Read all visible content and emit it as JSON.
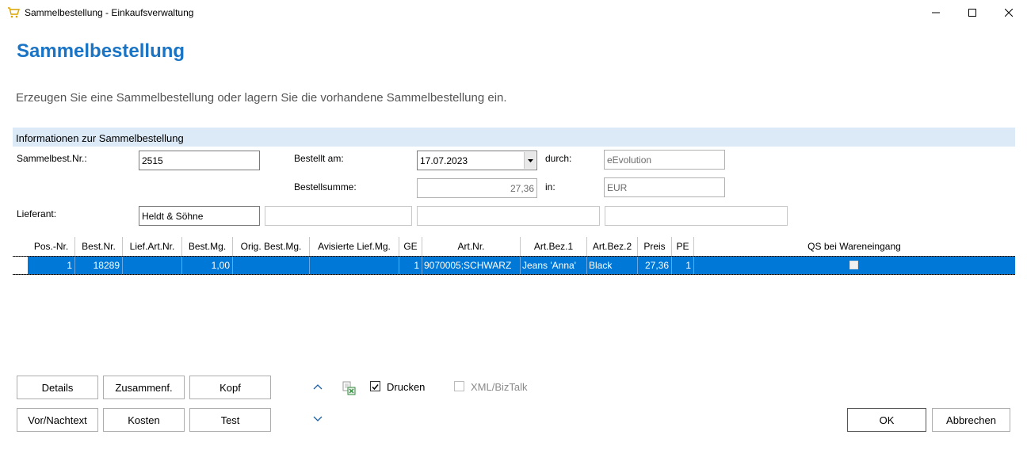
{
  "window": {
    "title": "Sammelbestellung - Einkaufsverwaltung",
    "app_icon": "shopping-cart-icon"
  },
  "page": {
    "title": "Sammelbestellung",
    "subtitle": "Erzeugen Sie eine Sammelbestellung oder lagern Sie die vorhandene Sammelbestellung ein."
  },
  "info": {
    "section_title": "Informationen zur Sammelbestellung",
    "sammelbest_nr_label": "Sammelbest.Nr.:",
    "sammelbest_nr_value": "2515",
    "bestellt_am_label": "Bestellt am:",
    "bestellt_am_value": "17.07.2023",
    "durch_label": "durch:",
    "durch_value": "eEvolution",
    "bestellsumme_label": "Bestellsumme:",
    "bestellsumme_value": "27,36",
    "in_label": "in:",
    "in_value": "EUR",
    "lieferant_label": "Lieferant:",
    "lieferant_value": "Heldt & Söhne"
  },
  "grid": {
    "columns": [
      "Pos.-Nr.",
      "Best.Nr.",
      "Lief.Art.Nr.",
      "Best.Mg.",
      "Orig. Best.Mg.",
      "Avisierte Lief.Mg.",
      "GE",
      "Art.Nr.",
      "Art.Bez.1",
      "Art.Bez.2",
      "Preis",
      "PE",
      "QS bei Wareneingang"
    ],
    "rows": [
      {
        "pos_nr": "1",
        "best_nr": "18289",
        "lief_art_nr": "",
        "best_mg": "1,00",
        "orig_best_mg": "",
        "avisierte_lief_mg": "",
        "ge": "1",
        "art_nr": "9070005;SCHWARZ",
        "art_bez1": "Jeans 'Anna'",
        "art_bez2": "Black",
        "preis": "27,36",
        "pe": "1",
        "qs": false
      }
    ]
  },
  "buttons": {
    "details": "Details",
    "zusammenf": "Zusammenf.",
    "kopf": "Kopf",
    "vor_nachtext": "Vor/Nachtext",
    "kosten": "Kosten",
    "test": "Test",
    "ok": "OK",
    "abbrechen": "Abbrechen"
  },
  "options": {
    "drucken_label": "Drucken",
    "drucken_checked": true,
    "xml_label": "XML/BizTalk",
    "xml_checked": false,
    "excel_icon": "excel-export-icon"
  },
  "colors": {
    "accent": "#1a74c6",
    "selection": "#0078d7",
    "section_bg": "#dce9f7"
  }
}
